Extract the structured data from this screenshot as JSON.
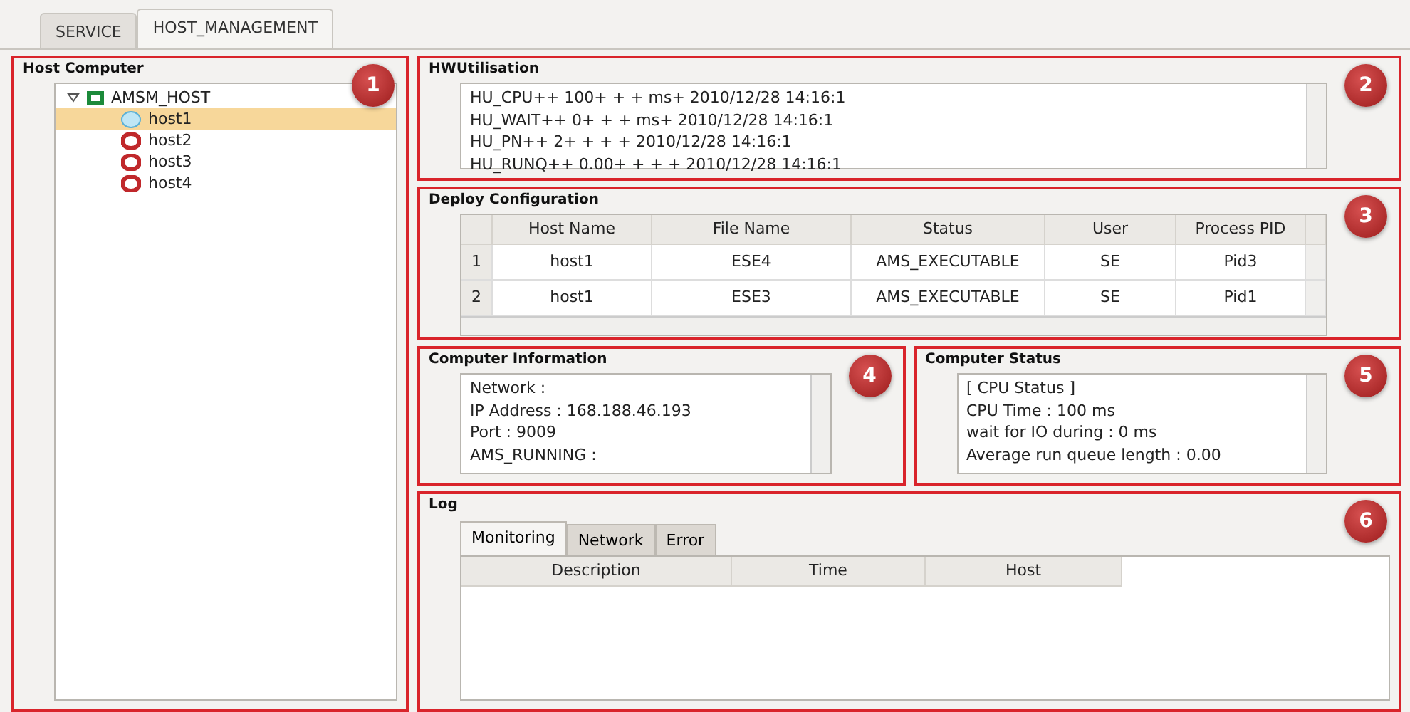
{
  "tabs": [
    {
      "label": "SERVICE",
      "selected": false
    },
    {
      "label": "HOST_MANAGEMENT",
      "selected": true
    }
  ],
  "host_computer": {
    "title": "Host Computer",
    "badge": "1",
    "tree": [
      {
        "label": "AMSM_HOST",
        "kind": "group",
        "expanded": true,
        "selected": false,
        "children": [
          {
            "label": "host1",
            "kind": "running",
            "selected": true
          },
          {
            "label": "host2",
            "kind": "stopped",
            "selected": false
          },
          {
            "label": "host3",
            "kind": "stopped",
            "selected": false
          },
          {
            "label": "host4",
            "kind": "stopped",
            "selected": false
          }
        ]
      }
    ]
  },
  "hw_utilisation": {
    "title": "HWUtilisation",
    "badge": "2",
    "lines": [
      "HU_CPU++ 100+ + + ms+ 2010/12/28 14:16:1",
      "HU_WAIT++ 0+ + + ms+ 2010/12/28 14:16:1",
      "HU_PN++ 2+ + + + 2010/12/28 14:16:1",
      "HU_RUNQ++ 0.00+ + + + 2010/12/28 14:16:1"
    ]
  },
  "deploy_configuration": {
    "title": "Deploy Configuration",
    "badge": "3",
    "columns": [
      "Host Name",
      "File Name",
      "Status",
      "User",
      "Process PID"
    ],
    "rows": [
      {
        "index": "1",
        "cells": [
          "host1",
          "ESE4",
          "AMS_EXECUTABLE",
          "SE",
          "Pid3"
        ]
      },
      {
        "index": "2",
        "cells": [
          "host1",
          "ESE3",
          "AMS_EXECUTABLE",
          "SE",
          "Pid1"
        ]
      }
    ]
  },
  "computer_information": {
    "title": "Computer Information",
    "badge": "4",
    "lines": [
      "Network :",
      "IP Address : 168.188.46.193",
      "Port : 9009",
      "AMS_RUNNING :"
    ]
  },
  "computer_status": {
    "title": "Computer Status",
    "badge": "5",
    "lines": [
      "[ CPU Status ]",
      "CPU Time : 100 ms",
      "wait for IO during : 0 ms",
      "Average run queue length : 0.00"
    ]
  },
  "log": {
    "title": "Log",
    "badge": "6",
    "tabs": [
      {
        "label": "Monitoring",
        "selected": true
      },
      {
        "label": "Network",
        "selected": false
      },
      {
        "label": "Error",
        "selected": false
      }
    ],
    "columns": [
      "Description",
      "Time",
      "Host"
    ]
  }
}
